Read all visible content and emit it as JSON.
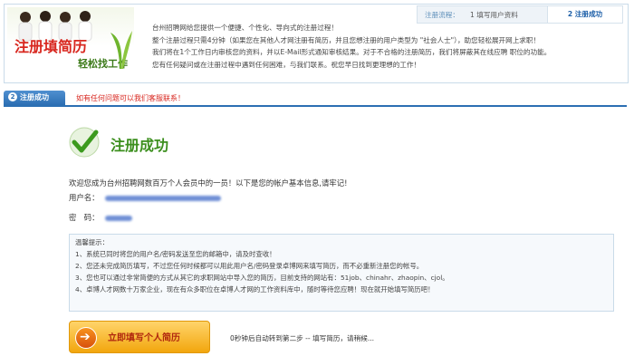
{
  "banner": {
    "title": "注册填简历",
    "subtitle": "轻松找工作"
  },
  "steps": {
    "label": "注册流程：",
    "step1": "1 填写用户资料",
    "step2": "2 注册成功"
  },
  "intro": [
    "台州招聘网给您提供一个便捷、个性化、导向式的注册过程！",
    "整个注册过程只需4分钟（如果您在其他人才网注册有简历，并且您想注册的用户类型为 \"社会人士\"），助您轻松展开网上求职！",
    "我们将在1个工作日内审核您的资料，并以E-Mail形式通知审核结果。对于不合格的注册简历，我们将屏蔽其在线应聘 职位的功能。",
    "您有任何疑问或在注册过程中遇到任何困难，与我们联系。祝您早日找到更理想的工作！"
  ],
  "tab": {
    "number": "2",
    "label": "注册成功"
  },
  "help_text": "如有任何问题可以我们客服联系！",
  "success_title": "注册成功",
  "welcome": "欢迎您成为台州招聘网数百万个人会员中的一员！以下是您的帐户基本信息,请牢记!",
  "account": {
    "username_label": "用户名：",
    "password_label": "密　码："
  },
  "tips": {
    "title": "温馨提示：",
    "lines": [
      "1、系统已同时将您的用户名/密码发送至您的邮箱中，请及时查收！",
      "2、您还未完成简历填写，不过您任何时候都可以用此用户名/密码登录卓博网来填写简历，而不必重新注册您的帐号。",
      "3、您也可以通过非常简便的方式从其它的求职网站中导入您的简历，目前支持的网站有：51job、chinahr、zhaopin、cjol。",
      "4、卓博人才网数十万家企业，现在有众多职位在卓博人才网的工作资料库中，随时等待您应聘！现在就开始填写简历吧！"
    ]
  },
  "cta": {
    "label": "立即填写个人简历"
  },
  "auto_redirect": "0秒钟后自动转到第二步 -- 填写简历，请稍候..."
}
